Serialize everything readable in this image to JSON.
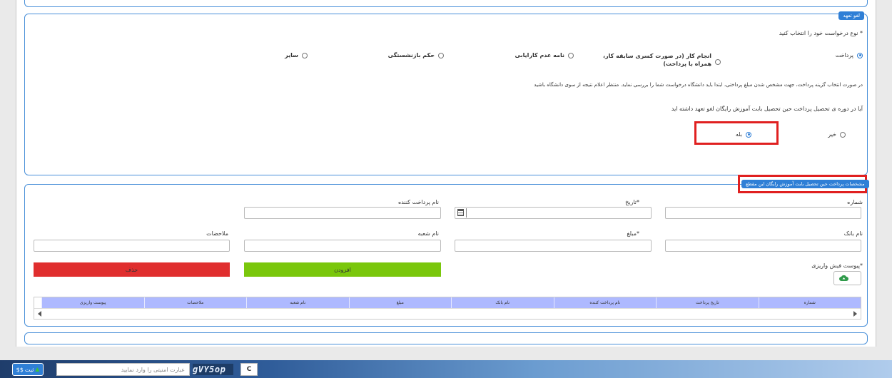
{
  "section1": {
    "legend": "لغو تعهد",
    "question": "* نوع درخواست خود را انتخاب کنید",
    "options": [
      {
        "label": "پرداخت",
        "selected": true
      },
      {
        "label": "انجام کار (در صورت کسری سابقه کار، همراه با پرداخت)",
        "selected": false
      },
      {
        "label": "نامه عدم کارایابی",
        "selected": false
      },
      {
        "label": "حکم بازنشستگی",
        "selected": false
      },
      {
        "label": "سایر",
        "selected": false
      }
    ],
    "note": "در صورت انتخاب گزینه پرداخت، جهت مشخص شدن مبلغ پرداختی، ابتدا باید دانشگاه درخواست شما را بررسی نماید. منتظر اعلام نتیجه از سوی دانشگاه باشید",
    "question2": "آیا در دوره ی تحصیل پرداخت حین تحصیل بابت آموزش رایگان لغو تعهد داشته اید",
    "yes": "بله",
    "no": "خیر"
  },
  "section2": {
    "legend": "مشخصات پرداخت حین تحصیل بابت آموزش رایگان این مقطع",
    "fields": {
      "number": "شماره",
      "date": "*تاریخ",
      "payer": "نام پرداخت کننده",
      "bank": "نام بانک",
      "amount": "*مبلغ",
      "branch": "نام شعبه",
      "notes": "ملاحضات"
    },
    "attachment_label": "*پیوست فیش واریزی",
    "add_button": "افزودن",
    "delete_button": "حذف",
    "table_headers": [
      "شماره",
      "تاریخ پرداخت",
      "نام پرداخت کننده",
      "نام بانک",
      "مبلغ",
      "نام شعبه",
      "ملاحضات",
      "پیوست واریزی"
    ]
  },
  "footer": {
    "submit_label": "ثبت",
    "captcha_placeholder": "عبارت امنیتی را وارد نمایید",
    "captcha_text": "gVY5op",
    "refresh_glyph": "C",
    "prefix": "$$"
  },
  "colors": {
    "accent": "#2f7fd6",
    "add_button": "#7ac70c",
    "delete_button": "#e02e2e",
    "table_header": "#aeb9ff",
    "highlight": "#e02020"
  }
}
